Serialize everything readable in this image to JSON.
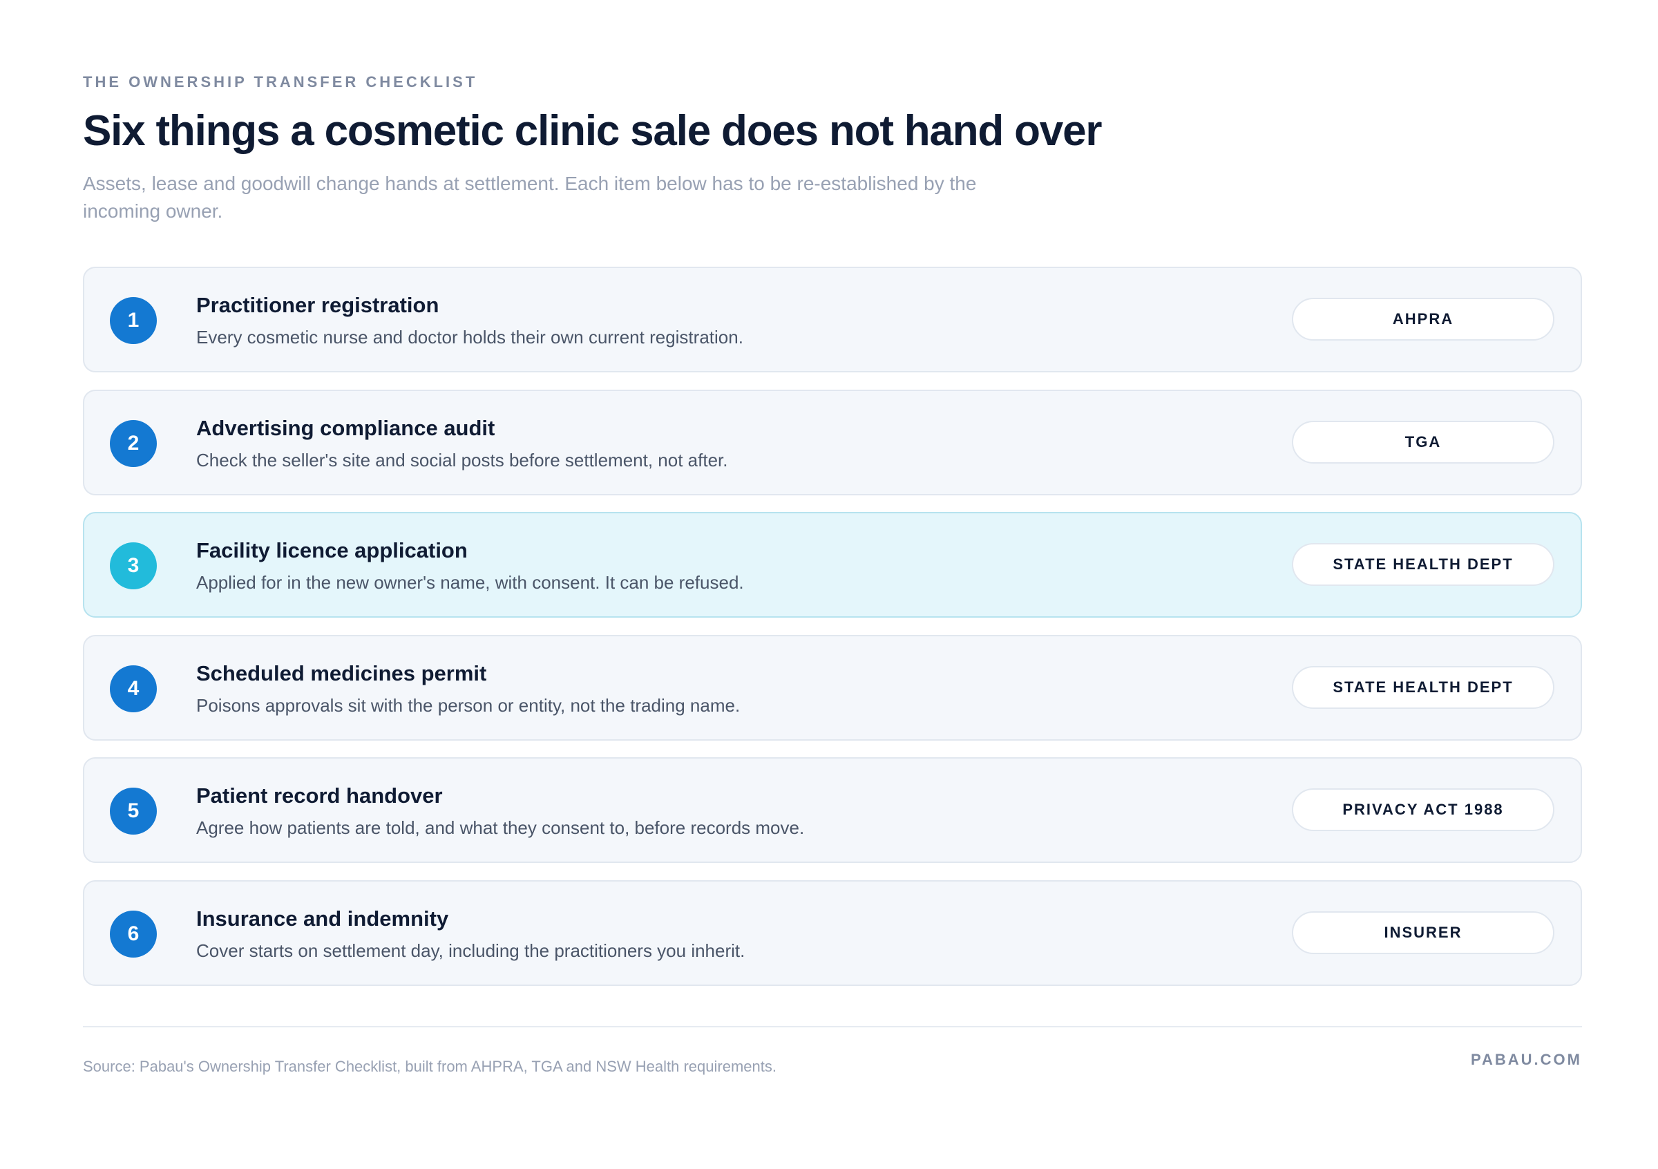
{
  "header": {
    "eyebrow": "THE OWNERSHIP TRANSFER CHECKLIST",
    "title": "Six things a cosmetic clinic sale does not hand over",
    "subtitle": "Assets, lease and goodwill change hands at settlement. Each item below has to be re-established by the incoming owner."
  },
  "items": [
    {
      "number": "1",
      "title": "Practitioner registration",
      "description": "Every cosmetic nurse and doctor holds their own current registration.",
      "badge": "AHPRA"
    },
    {
      "number": "2",
      "title": "Advertising compliance audit",
      "description": "Check the seller's site and social posts before settlement, not after.",
      "badge": "TGA"
    },
    {
      "number": "3",
      "title": "Facility licence application",
      "description": "Applied for in the new owner's name, with consent. It can be refused.",
      "badge": "STATE HEALTH DEPT"
    },
    {
      "number": "4",
      "title": "Scheduled medicines permit",
      "description": "Poisons approvals sit with the person or entity, not the trading name.",
      "badge": "STATE HEALTH DEPT"
    },
    {
      "number": "5",
      "title": "Patient record handover",
      "description": "Agree how patients are told, and what they consent to, before records move.",
      "badge": "PRIVACY ACT 1988"
    },
    {
      "number": "6",
      "title": "Insurance and indemnity",
      "description": "Cover starts on settlement day, including the practitioners you inherit.",
      "badge": "INSURER"
    }
  ],
  "footer": {
    "source": "Source: Pabau's Ownership Transfer Checklist, built from AHPRA, TGA and NSW Health requirements.",
    "brand": "PABAU.COM"
  },
  "colors": {
    "accent": "#1479d2",
    "highlight": "#22bbdb",
    "highlight_bg": "#e4f6fb",
    "text": "#0f1b33"
  }
}
